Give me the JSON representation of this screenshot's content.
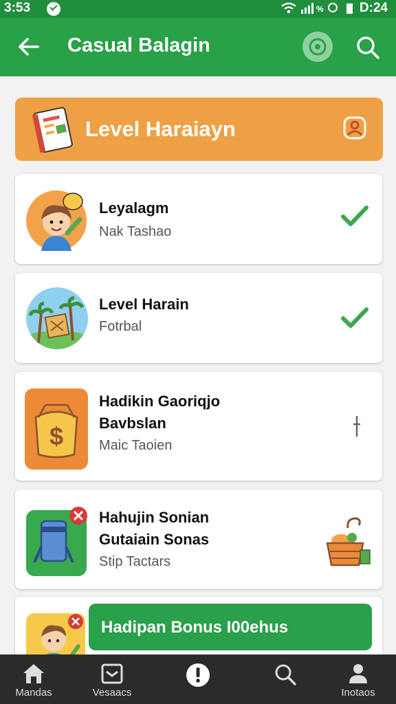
{
  "status_bar": {
    "time_left": "3:53",
    "time_right": "D:24",
    "indicators": "wifi signal"
  },
  "app_bar": {
    "title": "Casual Balagin",
    "back_icon": "arrow-left-icon",
    "action_icon": "target-icon",
    "search_icon": "search-icon"
  },
  "banner": {
    "title": "Level Haraiayn",
    "icon": "notebook-icon",
    "user_icon": "user-outline-icon"
  },
  "cards": [
    {
      "title": "Leyalagm",
      "subtitle": "Nak Tashao",
      "status_icon": "check-icon"
    },
    {
      "title": "Level Harain",
      "subtitle": "Fotrbal",
      "status_icon": "check-icon"
    },
    {
      "title_line1": "Hadikin Gaoriqjo",
      "title_line2": "Bavbslan",
      "subtitle": "Maic Taoien",
      "status_icon": "pin-icon"
    },
    {
      "title_line1": "Hahujin Sonian",
      "title_line2": "Gutaiain Sonas",
      "subtitle": "Stip Tactars",
      "status_icon": "basket-icon"
    }
  ],
  "promo_button": {
    "label": "Hadipan Bonus I00ehus"
  },
  "bottom_nav": [
    {
      "label": "Mandas",
      "icon": "home-icon"
    },
    {
      "label": "Vesaacs",
      "icon": "inbox-icon"
    },
    {
      "label": "",
      "icon": "alert-icon"
    },
    {
      "label": "",
      "icon": "search-icon"
    },
    {
      "label": "Inotaos",
      "icon": "person-icon"
    }
  ],
  "colors": {
    "primary_green": "#28a148",
    "status_green": "#1f8e3d",
    "banner_orange": "#f0a044",
    "check_green": "#3aa84c",
    "nav_dark": "#2b2b2b"
  }
}
